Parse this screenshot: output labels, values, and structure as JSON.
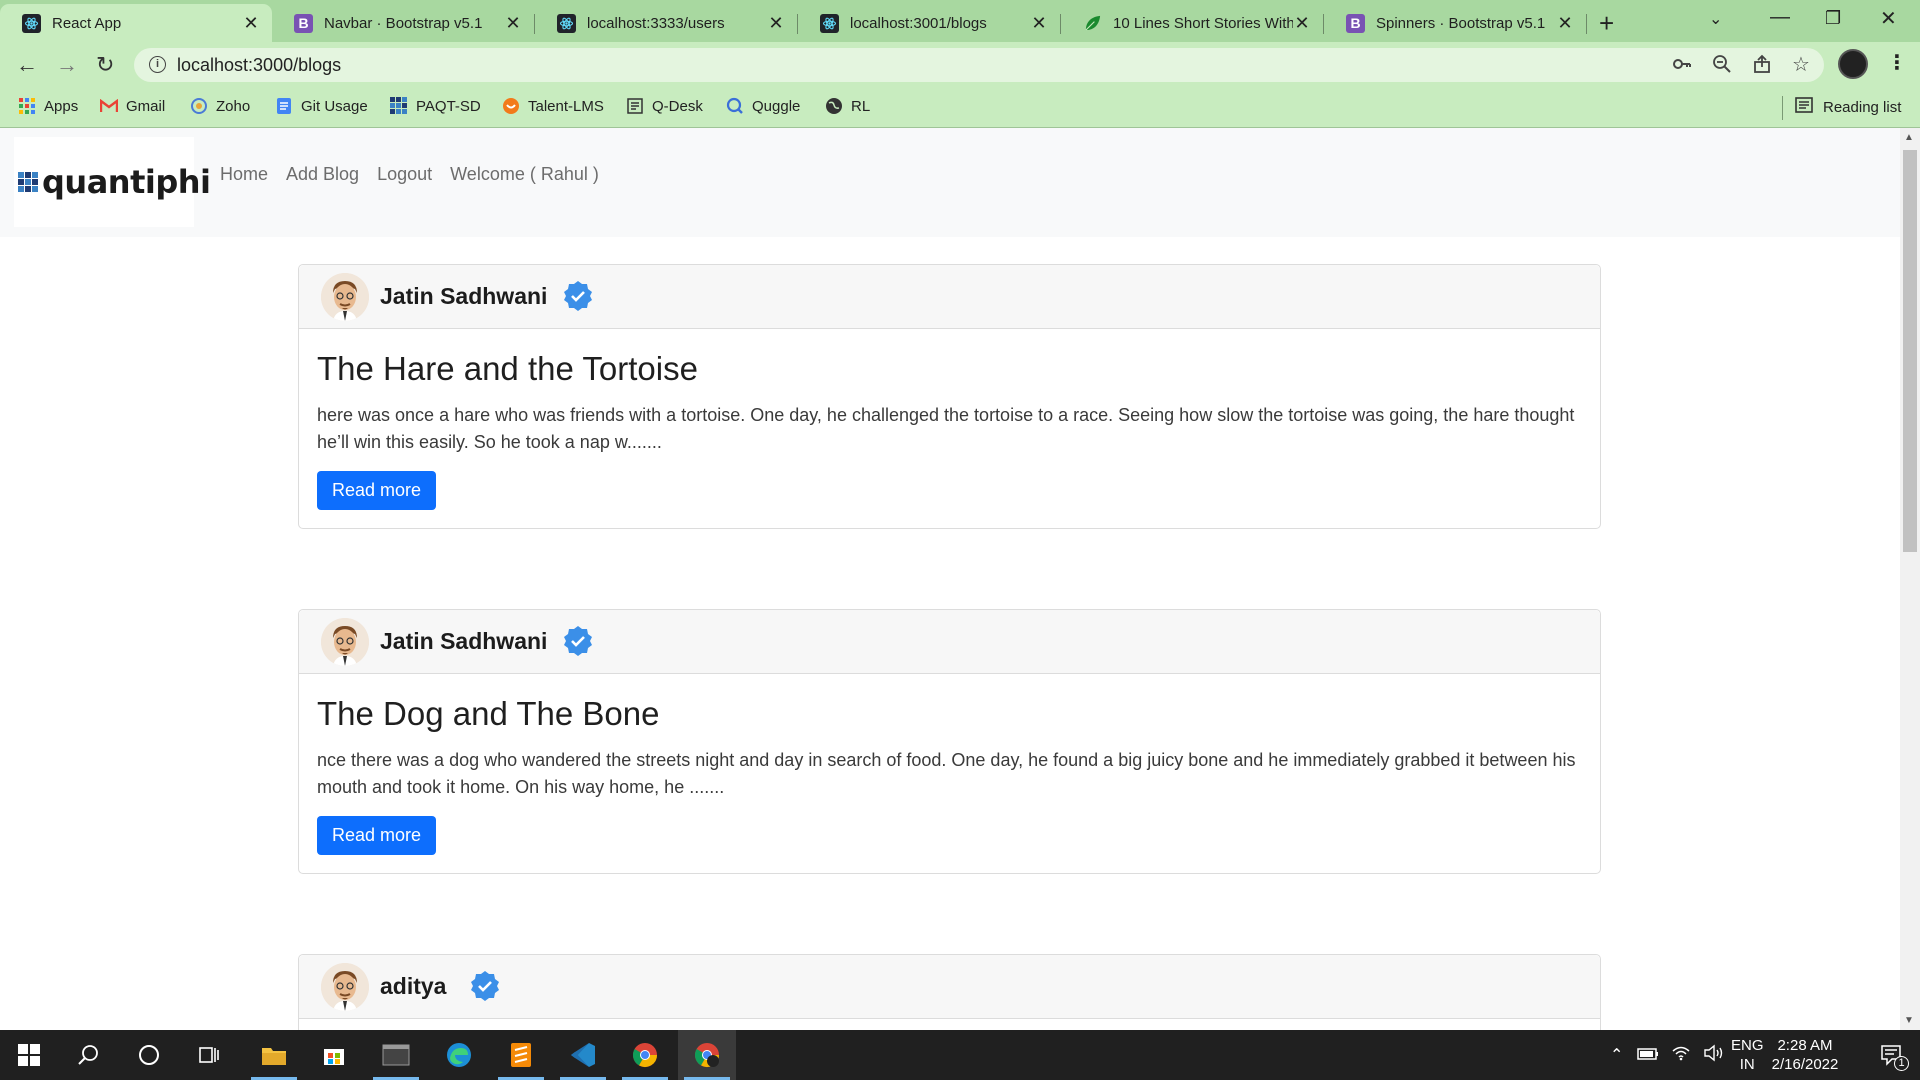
{
  "browser": {
    "tabs": [
      {
        "title": "React App",
        "favicon": "react-icon",
        "active": true
      },
      {
        "title": "Navbar · Bootstrap v5.1",
        "favicon": "bootstrap-icon",
        "active": false
      },
      {
        "title": "localhost:3333/users",
        "favicon": "react-icon",
        "active": false
      },
      {
        "title": "localhost:3001/blogs",
        "favicon": "react-icon",
        "active": false
      },
      {
        "title": "10 Lines Short Stories With",
        "favicon": "leaf-icon",
        "active": false
      },
      {
        "title": "Spinners · Bootstrap v5.1",
        "favicon": "bootstrap-icon",
        "active": false
      }
    ],
    "tab_close": "✕",
    "new_tab": "+",
    "url": "localhost:3000/blogs",
    "bookmarks": [
      {
        "label": "Apps",
        "icon": "apps-grid-icon"
      },
      {
        "label": "Gmail",
        "icon": "gmail-icon"
      },
      {
        "label": "Zoho",
        "icon": "zoho-icon"
      },
      {
        "label": "Git Usage",
        "icon": "docs-icon"
      },
      {
        "label": "PAQT-SD",
        "icon": "grid-icon"
      },
      {
        "label": "Talent-LMS",
        "icon": "talent-icon"
      },
      {
        "label": "Q-Desk",
        "icon": "qdesk-icon"
      },
      {
        "label": "Quggle",
        "icon": "quggle-icon"
      },
      {
        "label": "RL",
        "icon": "globe-icon"
      }
    ],
    "reading_list": "Reading list"
  },
  "app": {
    "logo_text": "quantiphi",
    "nav": {
      "home": "Home",
      "add_blog": "Add Blog",
      "logout": "Logout",
      "welcome": "Welcome ( Rahul )"
    },
    "read_more": "Read more",
    "posts": [
      {
        "author": "Jatin Sadhwani",
        "title": "The Hare and the Tortoise",
        "excerpt": "here was once a hare who was friends with a tortoise. One day, he challenged the tortoise to a race. Seeing how slow the tortoise was going, the hare thought he’ll win this easily. So he took a nap w......."
      },
      {
        "author": "Jatin Sadhwani",
        "title": "The Dog and The Bone",
        "excerpt": "nce there was a dog who wandered the streets night and day in search of food. One day, he found a big juicy bone and he immediately grabbed it between his mouth and took it home. On his way home, he ......."
      },
      {
        "author": "aditya",
        "title": "",
        "excerpt": ""
      }
    ],
    "colors": {
      "primary": "#0d6efd",
      "verified": "#3b8fe8"
    }
  },
  "taskbar": {
    "language": "ENG",
    "region": "IN",
    "time": "2:28 AM",
    "date": "2/16/2022",
    "notification_count": "1"
  }
}
